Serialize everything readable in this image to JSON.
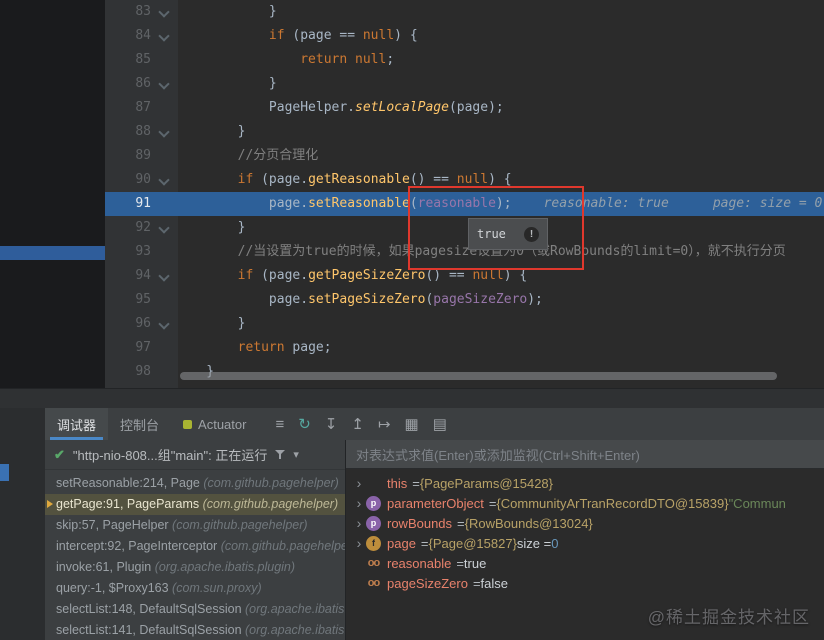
{
  "colors": {
    "execution_line": "#2d6099",
    "annotation_red": "#e0382d",
    "frame_selection": "#53523f",
    "thread_ok_green": "#59a869",
    "tab_underline_blue": "#4a88c7",
    "left_strip_selection_blue": "#2f5d9b"
  },
  "editor": {
    "current_line": 91,
    "inline_hints": [
      "reasonable: true",
      "page: size = 0"
    ],
    "tooltip": {
      "value": "true"
    },
    "lines": [
      {
        "num": 83,
        "mark": true,
        "tokens": [
          [
            "            }",
            "p"
          ]
        ]
      },
      {
        "num": 84,
        "mark": true,
        "tokens": [
          [
            "            ",
            "p"
          ],
          [
            "if",
            "k"
          ],
          [
            " (page == ",
            "p"
          ],
          [
            "null",
            "k"
          ],
          [
            ") {",
            "p"
          ]
        ]
      },
      {
        "num": 85,
        "mark": false,
        "tokens": [
          [
            "                ",
            "p"
          ],
          [
            "return",
            "k"
          ],
          [
            " ",
            "p"
          ],
          [
            "null",
            "k"
          ],
          [
            ";",
            "p"
          ]
        ]
      },
      {
        "num": 86,
        "mark": true,
        "tokens": [
          [
            "            }",
            "p"
          ]
        ]
      },
      {
        "num": 87,
        "mark": false,
        "tokens": [
          [
            "            PageHelper.",
            "p"
          ],
          [
            "setLocalPage",
            "ms"
          ],
          [
            "(page);",
            "p"
          ]
        ]
      },
      {
        "num": 88,
        "mark": true,
        "tokens": [
          [
            "        }",
            "p"
          ]
        ]
      },
      {
        "num": 89,
        "mark": false,
        "tokens": [
          [
            "        ",
            "p"
          ],
          [
            "//分页合理化",
            "c"
          ]
        ]
      },
      {
        "num": 90,
        "mark": true,
        "tokens": [
          [
            "        ",
            "p"
          ],
          [
            "if",
            "k"
          ],
          [
            " (page.",
            "p"
          ],
          [
            "getReasonable",
            "m"
          ],
          [
            "() == ",
            "p"
          ],
          [
            "null",
            "k"
          ],
          [
            ") {",
            "p"
          ]
        ]
      },
      {
        "num": 91,
        "mark": false,
        "tokens": [
          [
            "            page.",
            "p"
          ],
          [
            "setReasonable",
            "m"
          ],
          [
            "(",
            "p"
          ],
          [
            "reasonable",
            "f"
          ],
          [
            ");",
            "p"
          ]
        ]
      },
      {
        "num": 92,
        "mark": true,
        "tokens": [
          [
            "        }",
            "p"
          ]
        ]
      },
      {
        "num": 93,
        "mark": false,
        "tokens": [
          [
            "        ",
            "p"
          ],
          [
            "//当设置为true的时候，如果pagesize设置为0（或RowBounds的limit=0），就不执行分页",
            "c"
          ]
        ]
      },
      {
        "num": 94,
        "mark": true,
        "tokens": [
          [
            "        ",
            "p"
          ],
          [
            "if",
            "k"
          ],
          [
            " (page.",
            "p"
          ],
          [
            "getPageSizeZero",
            "m"
          ],
          [
            "() == ",
            "p"
          ],
          [
            "null",
            "k"
          ],
          [
            ") {",
            "p"
          ]
        ]
      },
      {
        "num": 95,
        "mark": false,
        "tokens": [
          [
            "            page.",
            "p"
          ],
          [
            "setPageSizeZero",
            "m"
          ],
          [
            "(",
            "p"
          ],
          [
            "pageSizeZero",
            "f"
          ],
          [
            ");",
            "p"
          ]
        ]
      },
      {
        "num": 96,
        "mark": true,
        "tokens": [
          [
            "        }",
            "p"
          ]
        ]
      },
      {
        "num": 97,
        "mark": false,
        "tokens": [
          [
            "        ",
            "p"
          ],
          [
            "return",
            "k"
          ],
          [
            " page;",
            "p"
          ]
        ]
      },
      {
        "num": 98,
        "mark": false,
        "tokens": [
          [
            "    }",
            "p"
          ]
        ]
      }
    ]
  },
  "debug": {
    "tabs": [
      {
        "id": "debugger",
        "label": "调试器",
        "selected": true
      },
      {
        "id": "console",
        "label": "控制台",
        "selected": false
      },
      {
        "id": "actuator",
        "label": "Actuator",
        "selected": false,
        "icon": "actuator-icon"
      }
    ],
    "toolbar_icons": [
      "view-menu",
      "rerun",
      "step-down",
      "step-up",
      "run-to-line",
      "grid-view",
      "layout-view"
    ],
    "thread": {
      "label": "\"http-nio-808...组\"main\": 正在运行"
    },
    "frames": [
      {
        "method": "setReasonable:214, Page",
        "location": "(com.github.pagehelper)",
        "selected": false
      },
      {
        "method": "getPage:91, PageParams",
        "location": "(com.github.pagehelper)",
        "selected": true
      },
      {
        "method": "skip:57, PageHelper",
        "location": "(com.github.pagehelper)",
        "selected": false
      },
      {
        "method": "intercept:92, PageInterceptor",
        "location": "(com.github.pagehelper)",
        "selected": false
      },
      {
        "method": "invoke:61, Plugin",
        "location": "(org.apache.ibatis.plugin)",
        "selected": false
      },
      {
        "method": "query:-1, $Proxy163",
        "location": "(com.sun.proxy)",
        "selected": false
      },
      {
        "method": "selectList:148, DefaultSqlSession",
        "location": "(org.apache.ibatis.session.defaults)",
        "selected": false
      },
      {
        "method": "selectList:141, DefaultSqlSession",
        "location": "(org.apache.ibatis.session.defaults)",
        "selected": false
      }
    ],
    "watch_placeholder": "对表达式求值(Enter)或添加监视(Ctrl+Shift+Enter)",
    "variables": [
      {
        "expand": true,
        "icon": null,
        "name": "this",
        "parts": [
          [
            "= ",
            "eq"
          ],
          [
            "{PageParams@15428}",
            "ref"
          ]
        ]
      },
      {
        "expand": true,
        "icon": "param",
        "name": "parameterObject",
        "parts": [
          [
            "= ",
            "eq"
          ],
          [
            "{CommunityArTranRecordDTO@15839}",
            "ref"
          ],
          [
            " \"Commun",
            "str"
          ]
        ]
      },
      {
        "expand": true,
        "icon": "param",
        "name": "rowBounds",
        "parts": [
          [
            "= ",
            "eq"
          ],
          [
            "{RowBounds@13024}",
            "ref"
          ]
        ]
      },
      {
        "expand": true,
        "icon": "field",
        "name": "page",
        "parts": [
          [
            "= ",
            "eq"
          ],
          [
            "{Page@15827}",
            "ref"
          ],
          [
            "  size = ",
            "plain"
          ],
          [
            "0",
            "num"
          ]
        ]
      },
      {
        "expand": false,
        "icon": "watch",
        "name": "reasonable",
        "parts": [
          [
            "= ",
            "eq"
          ],
          [
            "true",
            "plain"
          ]
        ]
      },
      {
        "expand": false,
        "icon": "watch",
        "name": "pageSizeZero",
        "parts": [
          [
            "= ",
            "eq"
          ],
          [
            "false",
            "plain"
          ]
        ]
      }
    ]
  },
  "watermark": "@稀土掘金技术社区"
}
